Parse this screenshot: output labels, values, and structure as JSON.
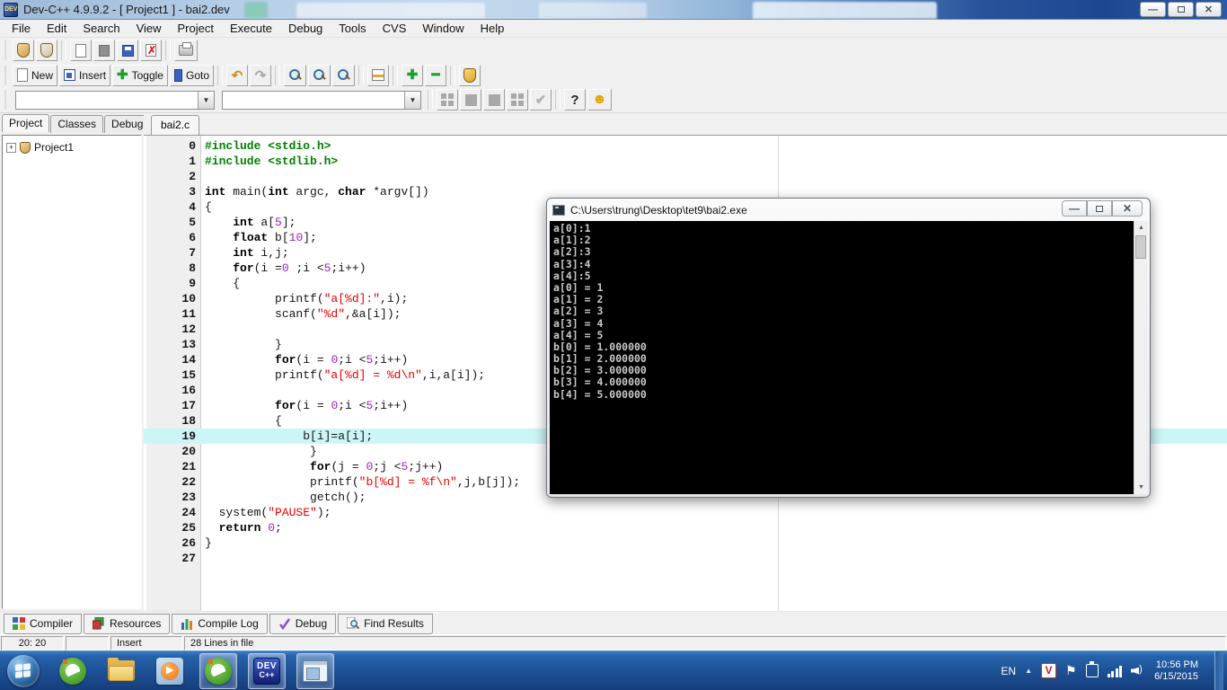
{
  "titlebar": {
    "title": "Dev-C++ 4.9.9.2  -  [ Project1 ] - bai2.dev"
  },
  "menubar": {
    "items": [
      "File",
      "Edit",
      "Search",
      "View",
      "Project",
      "Execute",
      "Debug",
      "Tools",
      "CVS",
      "Window",
      "Help"
    ]
  },
  "toolbar": {
    "new_label": "New",
    "insert_label": "Insert",
    "toggle_label": "Toggle",
    "goto_label": "Goto"
  },
  "sidebar": {
    "tabs": [
      "Project",
      "Classes",
      "Debug"
    ],
    "project": "Project1"
  },
  "editor": {
    "tab": "bai2.c",
    "highlight_line": 19,
    "colors": {
      "include": "#008000",
      "string": "#e80000",
      "number": "#a020c0",
      "highlight": "#ccf6f6"
    },
    "lines": [
      {
        "num": "0",
        "parts": [
          [
            "inc",
            "#include <stdio.h>"
          ]
        ]
      },
      {
        "num": "1",
        "parts": [
          [
            "inc",
            "#include <stdlib.h>"
          ]
        ]
      },
      {
        "num": "2",
        "parts": []
      },
      {
        "num": "3",
        "parts": [
          [
            "kw",
            "int"
          ],
          [
            "p",
            " main("
          ],
          [
            "kw",
            "int"
          ],
          [
            "p",
            " argc, "
          ],
          [
            "kw",
            "char"
          ],
          [
            "p",
            " *argv[])"
          ]
        ]
      },
      {
        "num": "4",
        "parts": [
          [
            "p",
            "{"
          ]
        ]
      },
      {
        "num": "5",
        "parts": [
          [
            "p",
            "    "
          ],
          [
            "kw",
            "int"
          ],
          [
            "p",
            " a["
          ],
          [
            "num",
            "5"
          ],
          [
            "p",
            "];"
          ]
        ]
      },
      {
        "num": "6",
        "parts": [
          [
            "p",
            "    "
          ],
          [
            "kw",
            "float"
          ],
          [
            "p",
            " b["
          ],
          [
            "num",
            "10"
          ],
          [
            "p",
            "];"
          ]
        ]
      },
      {
        "num": "7",
        "parts": [
          [
            "p",
            "    "
          ],
          [
            "kw",
            "int"
          ],
          [
            "p",
            " i,j;"
          ]
        ]
      },
      {
        "num": "8",
        "parts": [
          [
            "p",
            "    "
          ],
          [
            "kw",
            "for"
          ],
          [
            "p",
            "(i ="
          ],
          [
            "num",
            "0"
          ],
          [
            "p",
            " ;i <"
          ],
          [
            "num",
            "5"
          ],
          [
            "p",
            ";i++)"
          ]
        ]
      },
      {
        "num": "9",
        "parts": [
          [
            "p",
            "    {"
          ]
        ]
      },
      {
        "num": "10",
        "parts": [
          [
            "p",
            "          printf("
          ],
          [
            "str",
            "\"a[%d]:\""
          ],
          [
            "p",
            ",i);"
          ]
        ]
      },
      {
        "num": "11",
        "parts": [
          [
            "p",
            "          scanf("
          ],
          [
            "str",
            "\"%d\""
          ],
          [
            "p",
            ",&a[i]);"
          ]
        ]
      },
      {
        "num": "12",
        "parts": []
      },
      {
        "num": "13",
        "parts": [
          [
            "p",
            "          }"
          ]
        ]
      },
      {
        "num": "14",
        "parts": [
          [
            "p",
            "          "
          ],
          [
            "kw",
            "for"
          ],
          [
            "p",
            "(i = "
          ],
          [
            "num",
            "0"
          ],
          [
            "p",
            ";i <"
          ],
          [
            "num",
            "5"
          ],
          [
            "p",
            ";i++)"
          ]
        ]
      },
      {
        "num": "15",
        "parts": [
          [
            "p",
            "          printf("
          ],
          [
            "str",
            "\"a[%d] = %d\\n\""
          ],
          [
            "p",
            ",i,a[i]);"
          ]
        ]
      },
      {
        "num": "16",
        "parts": []
      },
      {
        "num": "17",
        "parts": [
          [
            "p",
            "          "
          ],
          [
            "kw",
            "for"
          ],
          [
            "p",
            "(i = "
          ],
          [
            "num",
            "0"
          ],
          [
            "p",
            ";i <"
          ],
          [
            "num",
            "5"
          ],
          [
            "p",
            ";i++)"
          ]
        ]
      },
      {
        "num": "18",
        "parts": [
          [
            "p",
            "          {"
          ]
        ]
      },
      {
        "num": "19",
        "parts": [
          [
            "p",
            "              b[i]=a[i];"
          ]
        ]
      },
      {
        "num": "20",
        "parts": [
          [
            "p",
            "               }"
          ]
        ]
      },
      {
        "num": "21",
        "parts": [
          [
            "p",
            "               "
          ],
          [
            "kw",
            "for"
          ],
          [
            "p",
            "(j = "
          ],
          [
            "num",
            "0"
          ],
          [
            "p",
            ";j <"
          ],
          [
            "num",
            "5"
          ],
          [
            "p",
            ";j++)"
          ]
        ]
      },
      {
        "num": "22",
        "parts": [
          [
            "p",
            "               printf("
          ],
          [
            "str",
            "\"b[%d] = %f\\n\""
          ],
          [
            "p",
            ",j,b[j]);"
          ]
        ]
      },
      {
        "num": "23",
        "parts": [
          [
            "p",
            "               getch();"
          ]
        ]
      },
      {
        "num": "24",
        "parts": [
          [
            "p",
            "  system("
          ],
          [
            "str",
            "\"PAUSE\""
          ],
          [
            "p",
            ");"
          ]
        ]
      },
      {
        "num": "25",
        "parts": [
          [
            "p",
            "  "
          ],
          [
            "kw",
            "return"
          ],
          [
            "p",
            " "
          ],
          [
            "num",
            "0"
          ],
          [
            "p",
            ";"
          ]
        ]
      },
      {
        "num": "26",
        "parts": [
          [
            "p",
            "}"
          ]
        ]
      },
      {
        "num": "27",
        "parts": []
      }
    ]
  },
  "console": {
    "title": "C:\\Users\\trung\\Desktop\\tet9\\bai2.exe",
    "lines": [
      "a[0]:1",
      "a[1]:2",
      "a[2]:3",
      "a[3]:4",
      "a[4]:5",
      "a[0] = 1",
      "a[1] = 2",
      "a[2] = 3",
      "a[3] = 4",
      "a[4] = 5",
      "b[0] = 1.000000",
      "b[1] = 2.000000",
      "b[2] = 3.000000",
      "b[3] = 4.000000",
      "b[4] = 5.000000"
    ]
  },
  "bottom_tabs": {
    "items": [
      {
        "label": "Compiler",
        "icon": "compiler-grid-icon"
      },
      {
        "label": "Resources",
        "icon": "resources-stack-icon"
      },
      {
        "label": "Compile Log",
        "icon": "compile-log-chart-icon"
      },
      {
        "label": "Debug",
        "icon": "debug-check-icon"
      },
      {
        "label": "Find Results",
        "icon": "find-results-icon"
      }
    ]
  },
  "statusbar": {
    "cursor": "20: 20",
    "mode": "Insert",
    "lines": "28 Lines in file"
  },
  "taskbar": {
    "lang": "EN",
    "time": "10:56 PM",
    "date": "6/15/2015"
  }
}
